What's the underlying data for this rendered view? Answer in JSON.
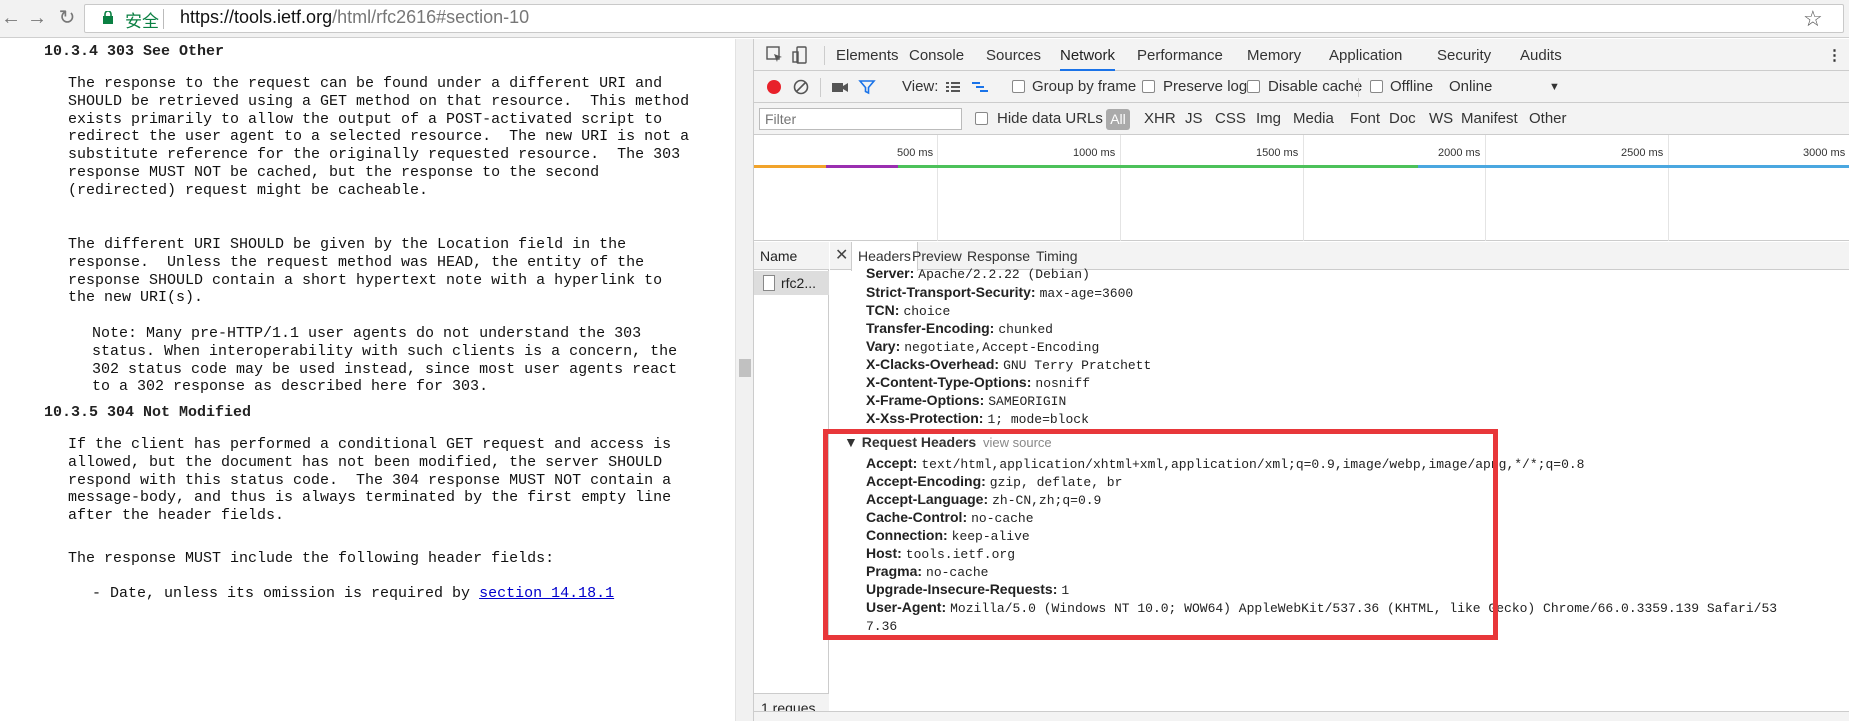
{
  "browser": {
    "secure_label": "安全",
    "url_scheme_host": "https://tools.ietf.org",
    "url_path": "/html/rfc2616#section-10",
    "icons": [
      "back-icon",
      "forward-icon",
      "reload-icon",
      "lock-icon",
      "star-icon"
    ]
  },
  "page": {
    "heading_303": "10.3.4 303 See Other",
    "para_303_1": "The response to the request can be found under a different URI and\nSHOULD be retrieved using a GET method on that resource.  This method\nexists primarily to allow the output of a POST-activated script to\nredirect the user agent to a selected resource.  The new URI is not a\nsubstitute reference for the originally requested resource.  The 303\nresponse MUST NOT be cached, but the response to the second\n(redirected) request might be cacheable.",
    "para_303_2": "The different URI SHOULD be given by the Location field in the\nresponse.  Unless the request method was HEAD, the entity of the\nresponse SHOULD contain a short hypertext note with a hyperlink to\nthe new URI(s).",
    "note_303": "Note: Many pre-HTTP/1.1 user agents do not understand the 303\nstatus. When interoperability with such clients is a concern, the\n302 status code may be used instead, since most user agents react\nto a 302 response as described here for 303.",
    "heading_304": "10.3.5 304 Not Modified",
    "para_304_1": "If the client has performed a conditional GET request and access is\nallowed, but the document has not been modified, the server SHOULD\nrespond with this status code.  The 304 response MUST NOT contain a\nmessage-body, and thus is always terminated by the first empty line\nafter the header fields.",
    "para_304_2": "The response MUST include the following header fields:",
    "bullet_prefix": "- Date, unless its omission is required by ",
    "bullet_link": "section 14.18.1"
  },
  "devtools": {
    "tabs": [
      "Elements",
      "Console",
      "Sources",
      "Network",
      "Performance",
      "Memory",
      "Application",
      "Security",
      "Audits"
    ],
    "active_tab": "Network",
    "toolbar": {
      "view_label": "View:",
      "group_by_frame": "Group by frame",
      "preserve_log": "Preserve log",
      "disable_cache": "Disable cache",
      "offline": "Offline",
      "throttling": "Online"
    },
    "filter": {
      "placeholder": "Filter",
      "hide_data_urls": "Hide data URLs",
      "types": [
        "All",
        "XHR",
        "JS",
        "CSS",
        "Img",
        "Media",
        "Font",
        "Doc",
        "WS",
        "Manifest",
        "Other"
      ]
    },
    "overview_ticks": [
      "500 ms",
      "1000 ms",
      "1500 ms",
      "2000 ms",
      "2500 ms",
      "3000 ms"
    ],
    "request_list": {
      "column_name": "Name",
      "rows": [
        "rfc2..."
      ],
      "footer": "1 reques..."
    },
    "details": {
      "tabs": [
        "Headers",
        "Preview",
        "Response",
        "Timing"
      ],
      "active_tab": "Headers",
      "response_headers": [
        {
          "name": "Server:",
          "value": "Apache/2.2.22 (Debian)"
        },
        {
          "name": "Strict-Transport-Security:",
          "value": "max-age=3600"
        },
        {
          "name": "TCN:",
          "value": "choice"
        },
        {
          "name": "Transfer-Encoding:",
          "value": "chunked"
        },
        {
          "name": "Vary:",
          "value": "negotiate,Accept-Encoding"
        },
        {
          "name": "X-Clacks-Overhead:",
          "value": "GNU Terry Pratchett"
        },
        {
          "name": "X-Content-Type-Options:",
          "value": "nosniff"
        },
        {
          "name": "X-Frame-Options:",
          "value": "SAMEORIGIN"
        },
        {
          "name": "X-Xss-Protection:",
          "value": "1; mode=block"
        }
      ],
      "request_headers_title": "Request Headers",
      "view_source": "view source",
      "request_headers": [
        {
          "name": "Accept:",
          "value": "text/html,application/xhtml+xml,application/xml;q=0.9,image/webp,image/apng,*/*;q=0.8"
        },
        {
          "name": "Accept-Encoding:",
          "value": "gzip, deflate, br"
        },
        {
          "name": "Accept-Language:",
          "value": "zh-CN,zh;q=0.9"
        },
        {
          "name": "Cache-Control:",
          "value": "no-cache"
        },
        {
          "name": "Connection:",
          "value": "keep-alive"
        },
        {
          "name": "Host:",
          "value": "tools.ietf.org"
        },
        {
          "name": "Pragma:",
          "value": "no-cache"
        },
        {
          "name": "Upgrade-Insecure-Requests:",
          "value": "1"
        },
        {
          "name": "User-Agent:",
          "value": "Mozilla/5.0 (Windows NT 10.0; WOW64) AppleWebKit/537.36 (KHTML, like Gecko) Chrome/66.0.3359.139 Safari/53"
        },
        {
          "name": "",
          "value": "7.36"
        }
      ]
    },
    "colors": {
      "accent": "#1a73e8",
      "record": "#e8212a",
      "highlight": "#e8373a"
    }
  }
}
